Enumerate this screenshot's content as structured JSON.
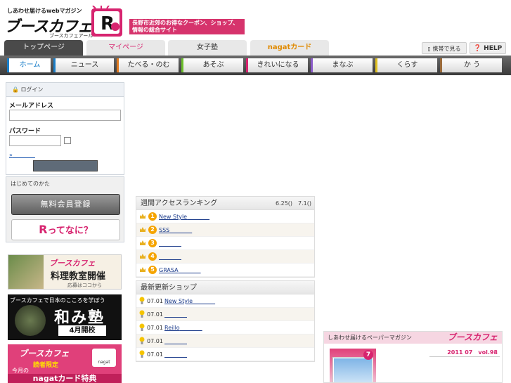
{
  "header": {
    "tagline": "しあわせ届けるwebマガジン",
    "logo": "ブースカフェ",
    "logo_sub": "ブースカフェアール",
    "badge_letter": "R",
    "banner": "長野市近郊のお得なクーポン、ショップ、情報の総合サイト"
  },
  "top_tabs": {
    "home": "トップページ",
    "mypage": "マイページ",
    "girls": "女子塾",
    "nagat": "nagatカード",
    "mobile": "携帯で見る",
    "help": "HELP"
  },
  "categories": [
    "ホーム",
    "ニュース",
    "たべる・のむ",
    "あそぶ",
    "きれいになる",
    "まなぶ",
    "くらす",
    "か う"
  ],
  "login": {
    "title": "ログイン",
    "email_label": "メールアドレス",
    "email_value": "",
    "password_label": "パスワード",
    "password_value": "",
    "forgot": "»",
    "submit": ""
  },
  "first_time": {
    "label": "はじめてのかた",
    "register": "無料会員登録",
    "about": "ってなに？",
    "about_letter": "R"
  },
  "ads": {
    "cooking_brand": "ブースカフェ",
    "cooking_title": "料理教室開催",
    "cooking_note": "応募はココから",
    "wamijuku_top": "ブースカフェで日本のこころを学ぼう",
    "wamijuku_title": "和み塾",
    "wamijuku_sub": "4月開校",
    "nagat_brand": "ブースカフェ",
    "nagat_label": "読者限定",
    "nagat_month": "今月の",
    "nagat_bottom": "nagatカード特典",
    "nagat_card": "nagat"
  },
  "ranking": {
    "title": "週間アクセスランキング",
    "period": "6.25()　7.1()",
    "items": [
      {
        "rank": "1",
        "name": "New Style"
      },
      {
        "rank": "2",
        "name": "SSS"
      },
      {
        "rank": "3",
        "name": ""
      },
      {
        "rank": "4",
        "name": ""
      },
      {
        "rank": "5",
        "name": "GRASA"
      }
    ]
  },
  "updates": {
    "title": "最新更新ショップ",
    "items": [
      {
        "date": "07.01",
        "name": "New Style"
      },
      {
        "date": "07.01",
        "name": ""
      },
      {
        "date": "07.01",
        "name": "Reillo"
      },
      {
        "date": "07.01",
        "name": ""
      },
      {
        "date": "07.01",
        "name": ""
      }
    ]
  },
  "magazine": {
    "title": "しあわせ届けるペーパーマガジン",
    "logo": "ブースカフェ",
    "issue": "2011 07　vol.98",
    "cover_badge": "7"
  },
  "colors": {
    "accent_pink": "#d7246f",
    "nav_dark": "#4a4a4a",
    "link_blue": "#1a3a8a",
    "rank_orange": "#f5a400"
  }
}
